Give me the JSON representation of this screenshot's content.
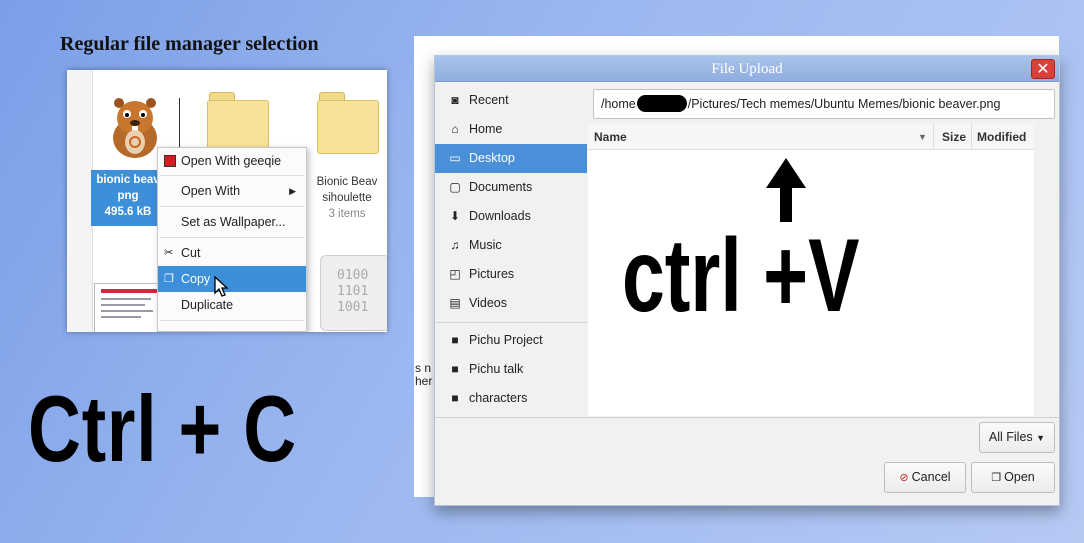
{
  "caption": "Regular file manager selection",
  "file_manager": {
    "selected_item": {
      "name_line1": "bionic beav",
      "name_line2": "png",
      "size": "495.6 kB"
    },
    "folder2": {
      "name_line1": "Bionic Beav",
      "name_line2": "sihoulette",
      "count": "3 items"
    },
    "binary_text": [
      "0100",
      "1101",
      "1001"
    ],
    "context_menu": {
      "open_with_app": "Open With geeqie",
      "open_with": "Open With",
      "set_wallpaper": "Set as Wallpaper...",
      "cut": "Cut",
      "copy": "Copy",
      "duplicate": "Duplicate"
    }
  },
  "big_left_text": "Ctrl + C",
  "page_fragment": [
    "s n",
    "her"
  ],
  "dialog": {
    "title": "File Upload",
    "close_glyph": "✕",
    "path_prefix": "/home",
    "path_suffix": "/Pictures/Tech memes/Ubuntu Memes/bionic beaver.png",
    "columns": {
      "name": "Name",
      "size": "Size",
      "modified": "Modified"
    },
    "sidebar": [
      {
        "label": "Recent",
        "icon": "recent-icon",
        "glyph": "◙"
      },
      {
        "label": "Home",
        "icon": "home-icon",
        "glyph": "⌂"
      },
      {
        "label": "Desktop",
        "icon": "desktop-icon",
        "glyph": "▭"
      },
      {
        "label": "Documents",
        "icon": "documents-icon",
        "glyph": "▢"
      },
      {
        "label": "Downloads",
        "icon": "downloads-icon",
        "glyph": "⬇"
      },
      {
        "label": "Music",
        "icon": "music-icon",
        "glyph": "♫"
      },
      {
        "label": "Pictures",
        "icon": "pictures-icon",
        "glyph": "◰"
      },
      {
        "label": "Videos",
        "icon": "videos-icon",
        "glyph": "▤"
      },
      {
        "label": "Pichu Project",
        "icon": "folder-icon",
        "glyph": "■"
      },
      {
        "label": "Pichu talk",
        "icon": "folder-icon",
        "glyph": "■"
      },
      {
        "label": "characters",
        "icon": "folder-icon",
        "glyph": "■"
      }
    ],
    "selected_sidebar": "Desktop",
    "filter_label": "All Files",
    "cancel_label": "Cancel",
    "open_label": "Open",
    "overlay_text": "ctrl +V"
  },
  "colors": {
    "selection": "#4a90d9",
    "titlebar": "#9ab7e5",
    "close": "#d8413a"
  }
}
